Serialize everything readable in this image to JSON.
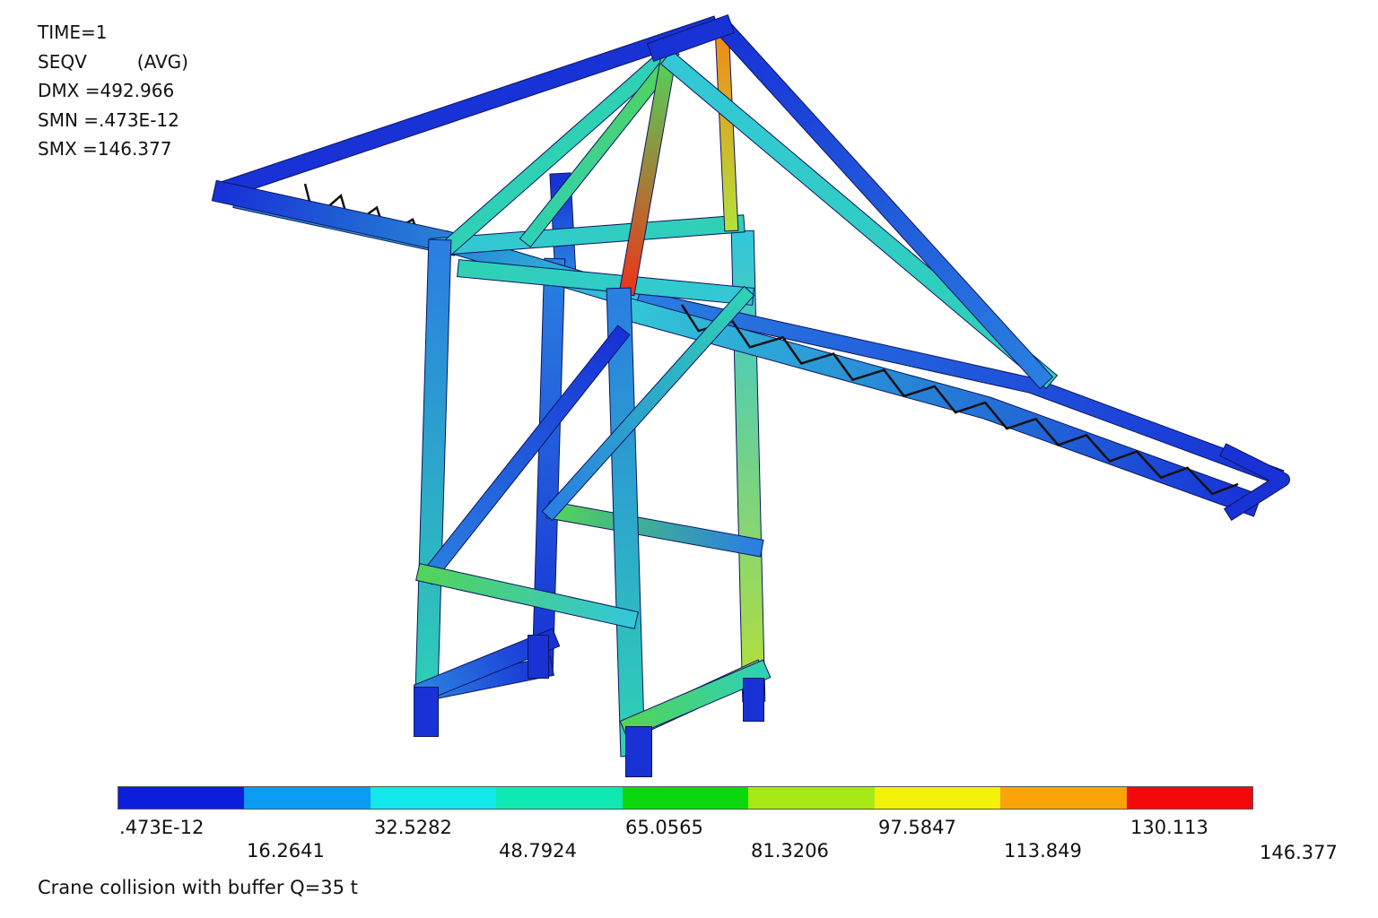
{
  "header": {
    "time": "TIME=1",
    "result": "SEQV",
    "avg": "(AVG)",
    "dmx": "DMX =492.966",
    "smn": "SMN =.473E-12",
    "smx": "SMX =146.377"
  },
  "legend": {
    "colors": [
      "#0a1edc",
      "#0a9cf2",
      "#12e8ea",
      "#10e8b2",
      "#0bd80c",
      "#a8e814",
      "#f4f20a",
      "#fba30a",
      "#f20808"
    ],
    "ticks": [
      ".473E-12",
      "16.2641",
      "32.5282",
      "48.7924",
      "65.0565",
      "81.3206",
      "97.5847",
      "113.849",
      "130.113",
      "146.377"
    ]
  },
  "caption": "Crane collision with buffer Q=35 t",
  "model_colors": {
    "dark_blue": "#1832d6",
    "blue": "#2a7fe0",
    "cyan": "#33c7d7",
    "teal": "#2fd1b4",
    "green": "#52d35a",
    "yellowgreen": "#b5de3a",
    "orange": "#f08a18",
    "red": "#e8381a",
    "edge": "#0c1560"
  }
}
